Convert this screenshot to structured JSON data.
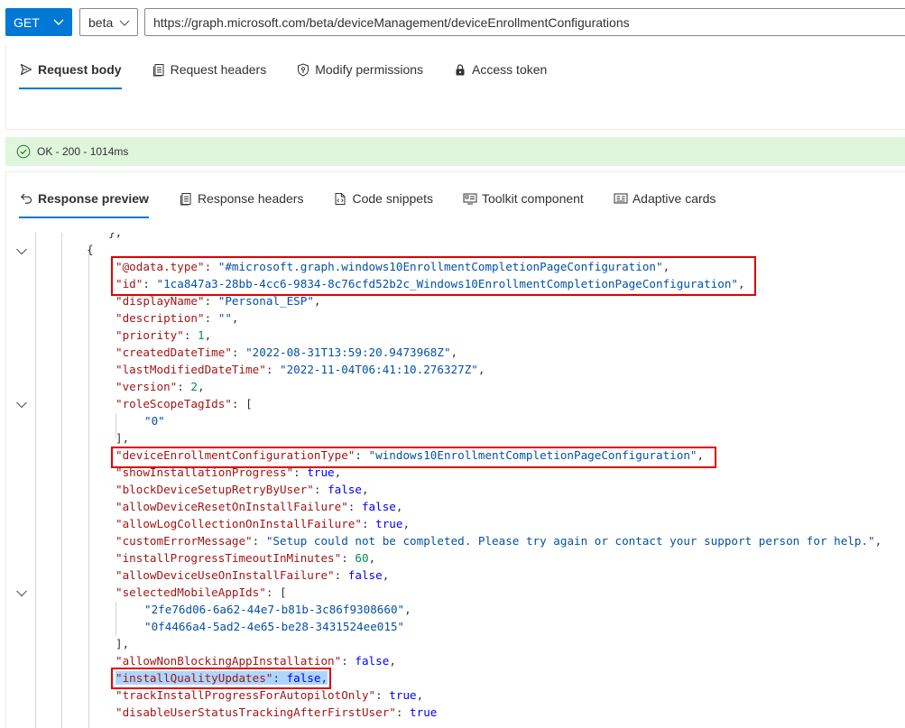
{
  "request": {
    "method": "GET",
    "version": "beta",
    "url": "https://graph.microsoft.com/beta/deviceManagement/deviceEnrollmentConfigurations"
  },
  "request_tabs": [
    {
      "label": "Request body",
      "icon": "send-icon",
      "active": true
    },
    {
      "label": "Request headers",
      "icon": "document-icon",
      "active": false
    },
    {
      "label": "Modify permissions",
      "icon": "shield-key-icon",
      "active": false
    },
    {
      "label": "Access token",
      "icon": "lock-icon",
      "active": false
    }
  ],
  "status": {
    "text": "OK - 200 - 1014ms",
    "color": "#dff6dd"
  },
  "response_tabs": [
    {
      "label": "Response preview",
      "icon": "return-arrow-icon",
      "active": true
    },
    {
      "label": "Response headers",
      "icon": "document-icon",
      "active": false
    },
    {
      "label": "Code snippets",
      "icon": "code-file-icon",
      "active": false
    },
    {
      "label": "Toolkit component",
      "icon": "component-icon",
      "active": false
    },
    {
      "label": "Adaptive cards",
      "icon": "card-icon",
      "active": false
    }
  ],
  "json": {
    "open_brace_prev": "},",
    "open_brace": "{",
    "lines": [
      {
        "key": "\"@odata.type\"",
        "sep": ": ",
        "val": "\"#microsoft.graph.windows10EnrollmentCompletionPageConfiguration\"",
        "vtype": "s",
        "tail": ","
      },
      {
        "key": "\"id\"",
        "sep": ": ",
        "val": "\"1ca847a3-28bb-4cc6-9834-8c76cfd52b2c_Windows10EnrollmentCompletionPageConfiguration\"",
        "vtype": "s",
        "tail": ","
      },
      {
        "key": "\"displayName\"",
        "sep": ": ",
        "val": "\"Personal_ESP\"",
        "vtype": "s",
        "tail": ","
      },
      {
        "key": "\"description\"",
        "sep": ": ",
        "val": "\"\"",
        "vtype": "s",
        "tail": ","
      },
      {
        "key": "\"priority\"",
        "sep": ": ",
        "val": "1",
        "vtype": "n",
        "tail": ","
      },
      {
        "key": "\"createdDateTime\"",
        "sep": ": ",
        "val": "\"2022-08-31T13:59:20.9473968Z\"",
        "vtype": "s",
        "tail": ","
      },
      {
        "key": "\"lastModifiedDateTime\"",
        "sep": ": ",
        "val": "\"2022-11-04T06:41:10.276327Z\"",
        "vtype": "s",
        "tail": ","
      },
      {
        "key": "\"version\"",
        "sep": ": ",
        "val": "2",
        "vtype": "n",
        "tail": ","
      },
      {
        "key": "\"roleScopeTagIds\"",
        "sep": ": ",
        "val": "[",
        "vtype": "p",
        "tail": ""
      },
      {
        "key": "",
        "sep": "",
        "val": "\"0\"",
        "vtype": "s",
        "tail": "",
        "indent": 1
      },
      {
        "key": "",
        "sep": "",
        "val": "],",
        "vtype": "p",
        "tail": ""
      },
      {
        "key": "\"deviceEnrollmentConfigurationType\"",
        "sep": ": ",
        "val": "\"windows10EnrollmentCompletionPageConfiguration\"",
        "vtype": "s",
        "tail": ","
      },
      {
        "key": "\"showInstallationProgress\"",
        "sep": ": ",
        "val": "true",
        "vtype": "b",
        "tail": ","
      },
      {
        "key": "\"blockDeviceSetupRetryByUser\"",
        "sep": ": ",
        "val": "false",
        "vtype": "b",
        "tail": ","
      },
      {
        "key": "\"allowDeviceResetOnInstallFailure\"",
        "sep": ": ",
        "val": "false",
        "vtype": "b",
        "tail": ","
      },
      {
        "key": "\"allowLogCollectionOnInstallFailure\"",
        "sep": ": ",
        "val": "true",
        "vtype": "b",
        "tail": ","
      },
      {
        "key": "\"customErrorMessage\"",
        "sep": ": ",
        "val": "\"Setup could not be completed. Please try again or contact your support person for help.\"",
        "vtype": "s",
        "tail": ","
      },
      {
        "key": "\"installProgressTimeoutInMinutes\"",
        "sep": ": ",
        "val": "60",
        "vtype": "n",
        "tail": ","
      },
      {
        "key": "\"allowDeviceUseOnInstallFailure\"",
        "sep": ": ",
        "val": "false",
        "vtype": "b",
        "tail": ","
      },
      {
        "key": "\"selectedMobileAppIds\"",
        "sep": ": ",
        "val": "[",
        "vtype": "p",
        "tail": ""
      },
      {
        "key": "",
        "sep": "",
        "val": "\"2fe76d06-6a62-44e7-b81b-3c86f9308660\"",
        "vtype": "s",
        "tail": ",",
        "indent": 1
      },
      {
        "key": "",
        "sep": "",
        "val": "\"0f4466a4-5ad2-4e65-be28-3431524ee015\"",
        "vtype": "s",
        "tail": "",
        "indent": 1
      },
      {
        "key": "",
        "sep": "",
        "val": "],",
        "vtype": "p",
        "tail": ""
      },
      {
        "key": "\"allowNonBlockingAppInstallation\"",
        "sep": ": ",
        "val": "false",
        "vtype": "b",
        "tail": ","
      },
      {
        "key": "\"installQualityUpdates\"",
        "sep": ": ",
        "val": "false",
        "vtype": "b",
        "tail": ",",
        "selected": true
      },
      {
        "key": "\"trackInstallProgressForAutopilotOnly\"",
        "sep": ": ",
        "val": "true",
        "vtype": "b",
        "tail": ","
      },
      {
        "key": "\"disableUserStatusTrackingAfterFirstUser\"",
        "sep": ": ",
        "val": "true",
        "vtype": "b",
        "tail": ""
      }
    ]
  }
}
